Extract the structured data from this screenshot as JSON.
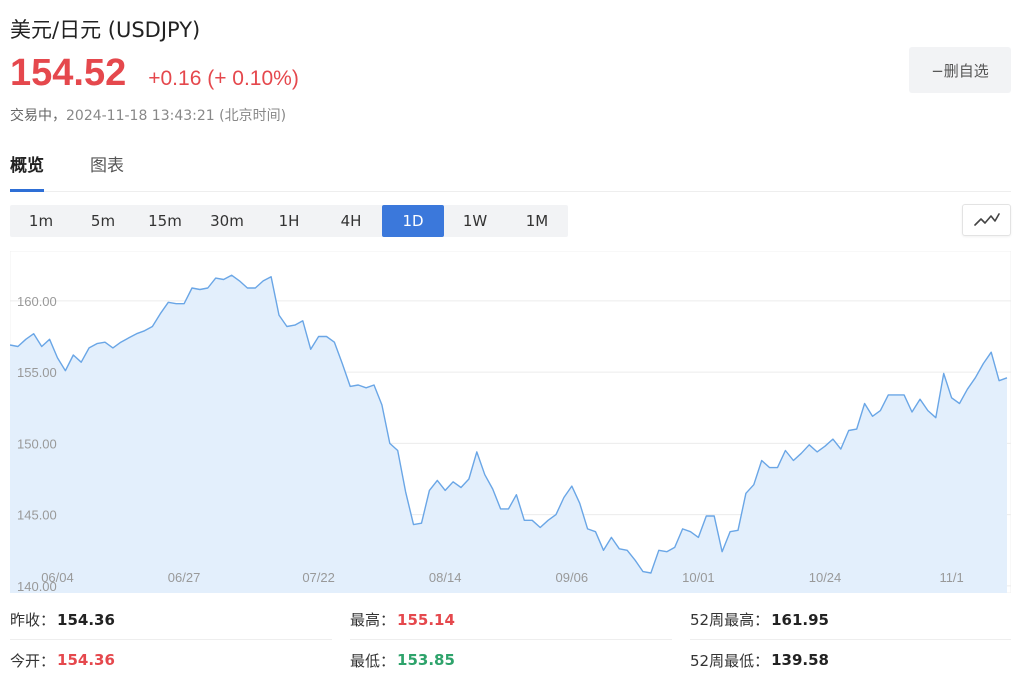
{
  "header": {
    "title": "美元/日元 (USDJPY)",
    "price": "154.52",
    "change": "+0.16 (+ 0.10%)",
    "status": "交易中，",
    "timestamp": "2024-11-18 13:43:21 (北京时间)",
    "watch_label": "−删自选"
  },
  "tabs": [
    {
      "label": "概览",
      "active": true
    },
    {
      "label": "图表",
      "active": false
    }
  ],
  "periods": [
    {
      "label": "1m"
    },
    {
      "label": "5m"
    },
    {
      "label": "15m"
    },
    {
      "label": "30m"
    },
    {
      "label": "1H"
    },
    {
      "label": "4H"
    },
    {
      "label": "1D",
      "active": true
    },
    {
      "label": "1W"
    },
    {
      "label": "1M"
    }
  ],
  "chart_type_icon": "line-chart-icon",
  "colors": {
    "up": "#e5484d",
    "down": "#2ea36b",
    "accent": "#3b78db",
    "line": "#6aa6e6",
    "fill": "#e3effc"
  },
  "chart_data": {
    "type": "area",
    "ylim": [
      139.5,
      163.5
    ],
    "yticks": [
      "160.00",
      "155.00",
      "150.00",
      "145.00",
      "140.00"
    ],
    "ytick_values": [
      160,
      155,
      150,
      145,
      140
    ],
    "xtick_labels": [
      "06/04",
      "06/27",
      "07/22",
      "08/14",
      "09/06",
      "10/01",
      "10/24",
      "11/1"
    ],
    "xtick_indices": [
      6,
      22,
      39,
      55,
      71,
      87,
      103,
      119
    ],
    "grid": true,
    "values": [
      156.9,
      156.8,
      157.3,
      157.7,
      156.8,
      157.3,
      156.0,
      155.1,
      156.2,
      155.7,
      156.7,
      157.0,
      157.1,
      156.7,
      157.1,
      157.4,
      157.7,
      157.9,
      158.2,
      159.1,
      159.9,
      159.8,
      159.8,
      160.9,
      160.8,
      160.9,
      161.6,
      161.5,
      161.8,
      161.4,
      160.9,
      160.9,
      161.4,
      161.7,
      159.0,
      158.2,
      158.3,
      158.6,
      156.6,
      157.5,
      157.5,
      157.1,
      155.6,
      154.0,
      154.1,
      153.9,
      154.1,
      152.7,
      150.0,
      149.5,
      146.6,
      144.3,
      144.4,
      146.7,
      147.4,
      146.7,
      147.3,
      146.9,
      147.5,
      149.4,
      147.8,
      146.8,
      145.4,
      145.4,
      146.4,
      144.6,
      144.6,
      144.1,
      144.6,
      145.0,
      146.2,
      147.0,
      145.8,
      144.0,
      143.8,
      142.5,
      143.4,
      142.6,
      142.5,
      141.8,
      141.0,
      140.9,
      142.5,
      142.4,
      142.7,
      144.0,
      143.8,
      143.4,
      144.9,
      144.9,
      142.4,
      143.8,
      143.9,
      146.5,
      147.1,
      148.8,
      148.3,
      148.3,
      149.5,
      148.8,
      149.3,
      149.9,
      149.4,
      149.8,
      150.3,
      149.6,
      150.9,
      151.0,
      152.8,
      151.9,
      152.3,
      153.4,
      153.4,
      153.4,
      152.2,
      153.1,
      152.3,
      151.8,
      154.9,
      153.2,
      152.8,
      153.8,
      154.6,
      155.6,
      156.4,
      154.4,
      154.6
    ]
  },
  "stats": [
    [
      {
        "label": "昨收：",
        "value": "154.36",
        "tone": "flat"
      },
      {
        "label": "最高：",
        "value": "155.14",
        "tone": "up"
      },
      {
        "label": "52周最高：",
        "value": "161.95",
        "tone": "flat"
      }
    ],
    [
      {
        "label": "今开：",
        "value": "154.36",
        "tone": "up"
      },
      {
        "label": "最低：",
        "value": "153.85",
        "tone": "down"
      },
      {
        "label": "52周最低：",
        "value": "139.58",
        "tone": "flat"
      }
    ]
  ]
}
